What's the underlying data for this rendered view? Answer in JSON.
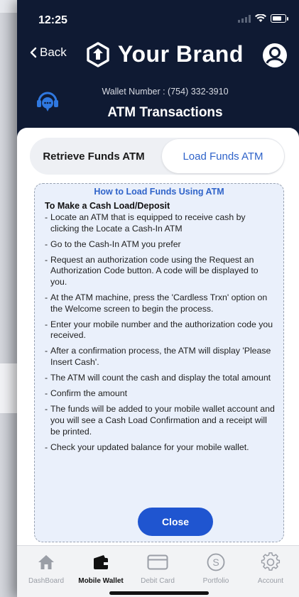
{
  "status_bar": {
    "time": "12:25"
  },
  "header": {
    "back_label": "Back",
    "brand_name": "Your Brand",
    "wallet_number": "Wallet Number : (754) 332-3910",
    "page_title": "ATM Transactions"
  },
  "tabs": {
    "retrieve_label": "Retrieve Funds ATM",
    "load_label": "Load Funds ATM",
    "selected": "Load Funds ATM"
  },
  "panel": {
    "title": "How to Load Funds Using ATM",
    "subtitle": "To Make a Cash Load/Deposit",
    "steps": [
      "Locate an ATM that is equipped to receive cash by clicking the Locate a Cash-In ATM",
      "Go to the Cash-In ATM you prefer",
      "Request an authorization code using the Request an Authorization Code button. A code will be displayed to you.",
      "At the ATM machine, press the 'Cardless Trxn' option on the Welcome screen to begin the process.",
      "Enter your mobile number and the authorization code you received.",
      "After a confirmation process, the ATM will display 'Please Insert Cash'.",
      "The ATM will count the cash and display the total amount",
      "Confirm the amount",
      "The funds will be added to your mobile wallet account and you will see a Cash Load Confirmation and a receipt will be printed.",
      "Check your updated balance for your mobile wallet."
    ],
    "close_label": "Close"
  },
  "tabbar": {
    "items": [
      {
        "label": "DashBoard",
        "icon": "home-icon"
      },
      {
        "label": "Mobile Wallet",
        "icon": "wallet-icon"
      },
      {
        "label": "Debit Card",
        "icon": "card-icon"
      },
      {
        "label": "Portfolio",
        "icon": "dollar-coin-icon"
      },
      {
        "label": "Account",
        "icon": "gear-icon"
      }
    ],
    "active": "Mobile Wallet"
  },
  "colors": {
    "header_bg": "#0f1a33",
    "accent_blue": "#1f55d0",
    "panel_bg": "#eaf0fb"
  }
}
